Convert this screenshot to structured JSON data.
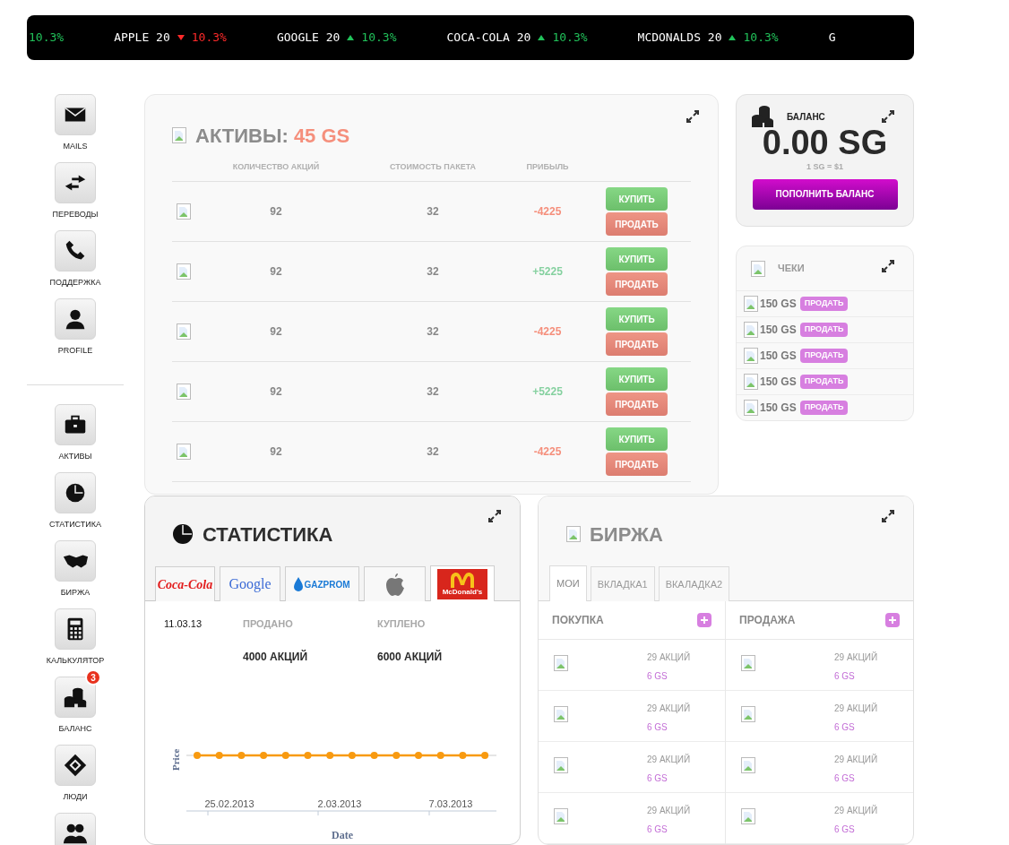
{
  "ticker": [
    {
      "kind": "change",
      "falling": false,
      "change": "10.3%"
    },
    {
      "kind": "quote",
      "name": "APPLE 20",
      "falling": true,
      "change": "10.3%"
    },
    {
      "kind": "quote",
      "name": "GOOGLE 20",
      "falling": false,
      "change": "10.3%"
    },
    {
      "kind": "quote",
      "name": "COCA-COLA 20",
      "falling": false,
      "change": "10.3%"
    },
    {
      "kind": "quote",
      "name": "MCDONALDS 20",
      "falling": false,
      "change": "10.3%"
    },
    {
      "kind": "name",
      "name": "G"
    }
  ],
  "sidebar": {
    "top_items": [
      {
        "label": "MAILS"
      },
      {
        "label": "ПЕРЕВОДЫ"
      },
      {
        "label": "ПОДДЕРЖКА"
      },
      {
        "label": "PROFILE"
      }
    ],
    "bottom_items": [
      {
        "label": "АКТИВЫ"
      },
      {
        "label": "СТАТИСТИКА"
      },
      {
        "label": "БИРЖА"
      },
      {
        "label": "КАЛЬКУЛЯТОР"
      },
      {
        "label": "БАЛАНС",
        "badge": "3"
      },
      {
        "label": "ЛЮДИ"
      },
      {
        "cut_off": true
      }
    ]
  },
  "assets": {
    "title": "АКТИВЫ:",
    "total": "45 GS",
    "columns": [
      "КОЛИЧЕСТВО АКЦИЙ",
      "СТОИМОСТЬ ПАКЕТА",
      "ПРИБЫЛЬ"
    ],
    "rows": [
      {
        "shares": "92",
        "cost": "32",
        "profit": "-4225",
        "loss": true,
        "buy": "КУПИТЬ",
        "sell": "ПРОДАТЬ"
      },
      {
        "shares": "92",
        "cost": "32",
        "profit": "+5225",
        "loss": false,
        "buy": "КУПИТЬ",
        "sell": "ПРОДАТЬ"
      },
      {
        "shares": "92",
        "cost": "32",
        "profit": "-4225",
        "loss": true,
        "buy": "КУПИТЬ",
        "sell": "ПРОДАТЬ"
      },
      {
        "shares": "92",
        "cost": "32",
        "profit": "+5225",
        "loss": false,
        "buy": "КУПИТЬ",
        "sell": "ПРОДАТЬ"
      },
      {
        "shares": "92",
        "cost": "32",
        "profit": "-4225",
        "loss": true,
        "buy": "КУПИТЬ",
        "sell": "ПРОДАТЬ"
      }
    ]
  },
  "balance": {
    "title": "БАЛАНС",
    "amount": "0.00 SG",
    "rate": "1 SG = $1",
    "button": "ПОПОЛНИТЬ БАЛАНС"
  },
  "checks": {
    "title": "ЧЕКИ",
    "rows": [
      {
        "amount": "150 GS",
        "button": "ПРОДАТЬ"
      },
      {
        "amount": "150 GS",
        "button": "ПРОДАТЬ"
      },
      {
        "amount": "150 GS",
        "button": "ПРОДАТЬ"
      },
      {
        "amount": "150 GS",
        "button": "ПРОДАТЬ"
      },
      {
        "amount": "150 GS",
        "button": "ПРОДАТЬ"
      }
    ]
  },
  "statistics": {
    "title": "СТАТИСТИКА",
    "tabs": [
      {
        "kind": "cocacola",
        "label": "Coca-Cola",
        "selected": false
      },
      {
        "kind": "google",
        "label": "Google",
        "selected": false
      },
      {
        "kind": "gazprom",
        "label": "GAZPROM",
        "selected": false
      },
      {
        "kind": "apple",
        "selected": false
      },
      {
        "kind": "mcdonalds",
        "label": "McDonald's",
        "selected": true
      }
    ],
    "date": "11.03.13",
    "sold_label": "ПРОДАНО",
    "sold": "4000 АКЦИЙ",
    "bought_label": "КУПЛЕНО",
    "bought": "6000 АКЦИЙ",
    "chart": {
      "ylabel": "Price",
      "xlabel": "Date",
      "tick_labels": [
        "25.02.2013",
        "2.03.2013",
        "7.03.2013"
      ]
    }
  },
  "exchange": {
    "title": "БИРЖА",
    "tabs": [
      {
        "label": "МОИ",
        "selected": true
      },
      {
        "label": "ВКЛАДКА1",
        "selected": false
      },
      {
        "label": "ВКАЛАДКА2",
        "selected": false
      }
    ],
    "columns": [
      {
        "title": "ПОКУПКА",
        "rows": [
          {
            "shares": "29 АКЦИЙ",
            "price": "6 GS"
          },
          {
            "shares": "29 АКЦИЙ",
            "price": "6 GS"
          },
          {
            "shares": "29 АКЦИЙ",
            "price": "6 GS"
          },
          {
            "shares": "29 АКЦИЙ",
            "price": "6 GS"
          }
        ]
      },
      {
        "title": "ПРОДАЖА",
        "rows": [
          {
            "shares": "29 АКЦИЙ",
            "price": "6 GS"
          },
          {
            "shares": "29 АКЦИЙ",
            "price": "6 GS"
          },
          {
            "shares": "29 АКЦИЙ",
            "price": "6 GS"
          },
          {
            "shares": "29 АКЦИЙ",
            "price": "6 GS"
          }
        ]
      }
    ]
  }
}
